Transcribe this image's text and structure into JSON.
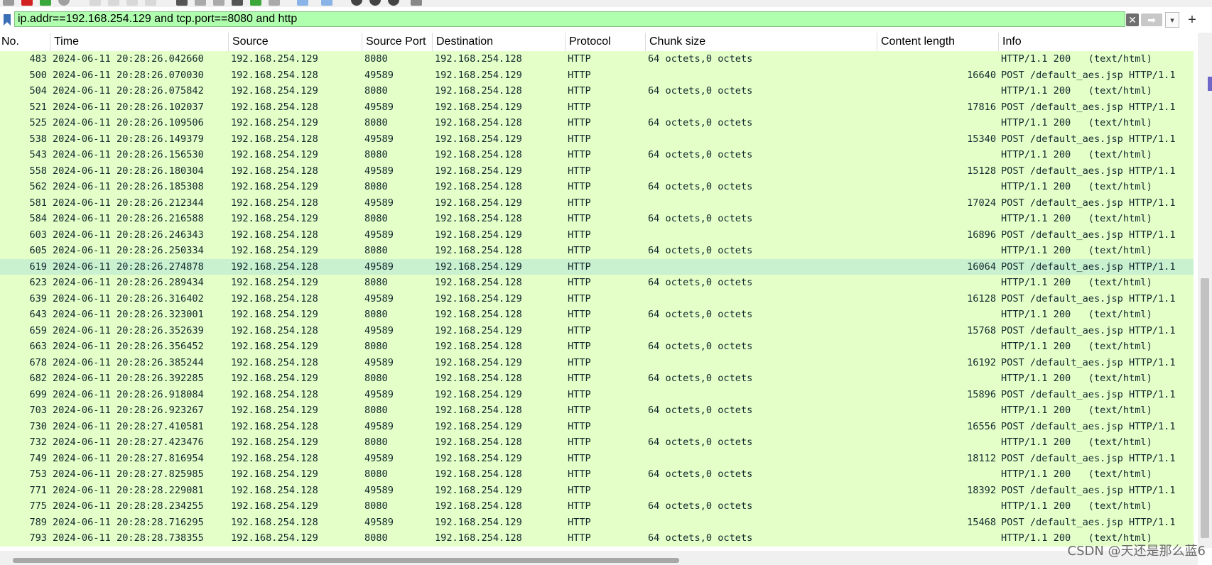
{
  "filter": {
    "value": "ip.addr==192.168.254.129 and tcp.port==8080 and http",
    "clear_glyph": "✕",
    "apply_glyph": "➡",
    "recent_glyph": "▾",
    "add_glyph": "+"
  },
  "columns": [
    "No.",
    "Time",
    "Source",
    "Source Port",
    "Destination",
    "Protocol",
    "Chunk size",
    "Content length",
    "Info"
  ],
  "rows": [
    {
      "no": "483",
      "time": "2024-06-11 20:28:26.042660",
      "src": "192.168.254.129",
      "sport": "8080",
      "dst": "192.168.254.128",
      "proto": "HTTP",
      "chunk": "64 octets,0 octets",
      "clen": "",
      "info": "HTTP/1.1 200   (text/html)"
    },
    {
      "no": "500",
      "time": "2024-06-11 20:28:26.070030",
      "src": "192.168.254.128",
      "sport": "49589",
      "dst": "192.168.254.129",
      "proto": "HTTP",
      "chunk": "",
      "clen": "16640",
      "info": "POST /default_aes.jsp HTTP/1.1"
    },
    {
      "no": "504",
      "time": "2024-06-11 20:28:26.075842",
      "src": "192.168.254.129",
      "sport": "8080",
      "dst": "192.168.254.128",
      "proto": "HTTP",
      "chunk": "64 octets,0 octets",
      "clen": "",
      "info": "HTTP/1.1 200   (text/html)"
    },
    {
      "no": "521",
      "time": "2024-06-11 20:28:26.102037",
      "src": "192.168.254.128",
      "sport": "49589",
      "dst": "192.168.254.129",
      "proto": "HTTP",
      "chunk": "",
      "clen": "17816",
      "info": "POST /default_aes.jsp HTTP/1.1"
    },
    {
      "no": "525",
      "time": "2024-06-11 20:28:26.109506",
      "src": "192.168.254.129",
      "sport": "8080",
      "dst": "192.168.254.128",
      "proto": "HTTP",
      "chunk": "64 octets,0 octets",
      "clen": "",
      "info": "HTTP/1.1 200   (text/html)"
    },
    {
      "no": "538",
      "time": "2024-06-11 20:28:26.149379",
      "src": "192.168.254.128",
      "sport": "49589",
      "dst": "192.168.254.129",
      "proto": "HTTP",
      "chunk": "",
      "clen": "15340",
      "info": "POST /default_aes.jsp HTTP/1.1"
    },
    {
      "no": "543",
      "time": "2024-06-11 20:28:26.156530",
      "src": "192.168.254.129",
      "sport": "8080",
      "dst": "192.168.254.128",
      "proto": "HTTP",
      "chunk": "64 octets,0 octets",
      "clen": "",
      "info": "HTTP/1.1 200   (text/html)"
    },
    {
      "no": "558",
      "time": "2024-06-11 20:28:26.180304",
      "src": "192.168.254.128",
      "sport": "49589",
      "dst": "192.168.254.129",
      "proto": "HTTP",
      "chunk": "",
      "clen": "15128",
      "info": "POST /default_aes.jsp HTTP/1.1"
    },
    {
      "no": "562",
      "time": "2024-06-11 20:28:26.185308",
      "src": "192.168.254.129",
      "sport": "8080",
      "dst": "192.168.254.128",
      "proto": "HTTP",
      "chunk": "64 octets,0 octets",
      "clen": "",
      "info": "HTTP/1.1 200   (text/html)"
    },
    {
      "no": "581",
      "time": "2024-06-11 20:28:26.212344",
      "src": "192.168.254.128",
      "sport": "49589",
      "dst": "192.168.254.129",
      "proto": "HTTP",
      "chunk": "",
      "clen": "17024",
      "info": "POST /default_aes.jsp HTTP/1.1"
    },
    {
      "no": "584",
      "time": "2024-06-11 20:28:26.216588",
      "src": "192.168.254.129",
      "sport": "8080",
      "dst": "192.168.254.128",
      "proto": "HTTP",
      "chunk": "64 octets,0 octets",
      "clen": "",
      "info": "HTTP/1.1 200   (text/html)"
    },
    {
      "no": "603",
      "time": "2024-06-11 20:28:26.246343",
      "src": "192.168.254.128",
      "sport": "49589",
      "dst": "192.168.254.129",
      "proto": "HTTP",
      "chunk": "",
      "clen": "16896",
      "info": "POST /default_aes.jsp HTTP/1.1"
    },
    {
      "no": "605",
      "time": "2024-06-11 20:28:26.250334",
      "src": "192.168.254.129",
      "sport": "8080",
      "dst": "192.168.254.128",
      "proto": "HTTP",
      "chunk": "64 octets,0 octets",
      "clen": "",
      "info": "HTTP/1.1 200   (text/html)"
    },
    {
      "no": "619",
      "time": "2024-06-11 20:28:26.274878",
      "src": "192.168.254.128",
      "sport": "49589",
      "dst": "192.168.254.129",
      "proto": "HTTP",
      "chunk": "",
      "clen": "16064",
      "info": "POST /default_aes.jsp HTTP/1.1",
      "selected": true
    },
    {
      "no": "623",
      "time": "2024-06-11 20:28:26.289434",
      "src": "192.168.254.129",
      "sport": "8080",
      "dst": "192.168.254.128",
      "proto": "HTTP",
      "chunk": "64 octets,0 octets",
      "clen": "",
      "info": "HTTP/1.1 200   (text/html)"
    },
    {
      "no": "639",
      "time": "2024-06-11 20:28:26.316402",
      "src": "192.168.254.128",
      "sport": "49589",
      "dst": "192.168.254.129",
      "proto": "HTTP",
      "chunk": "",
      "clen": "16128",
      "info": "POST /default_aes.jsp HTTP/1.1"
    },
    {
      "no": "643",
      "time": "2024-06-11 20:28:26.323001",
      "src": "192.168.254.129",
      "sport": "8080",
      "dst": "192.168.254.128",
      "proto": "HTTP",
      "chunk": "64 octets,0 octets",
      "clen": "",
      "info": "HTTP/1.1 200   (text/html)"
    },
    {
      "no": "659",
      "time": "2024-06-11 20:28:26.352639",
      "src": "192.168.254.128",
      "sport": "49589",
      "dst": "192.168.254.129",
      "proto": "HTTP",
      "chunk": "",
      "clen": "15768",
      "info": "POST /default_aes.jsp HTTP/1.1"
    },
    {
      "no": "663",
      "time": "2024-06-11 20:28:26.356452",
      "src": "192.168.254.129",
      "sport": "8080",
      "dst": "192.168.254.128",
      "proto": "HTTP",
      "chunk": "64 octets,0 octets",
      "clen": "",
      "info": "HTTP/1.1 200   (text/html)"
    },
    {
      "no": "678",
      "time": "2024-06-11 20:28:26.385244",
      "src": "192.168.254.128",
      "sport": "49589",
      "dst": "192.168.254.129",
      "proto": "HTTP",
      "chunk": "",
      "clen": "16192",
      "info": "POST /default_aes.jsp HTTP/1.1"
    },
    {
      "no": "682",
      "time": "2024-06-11 20:28:26.392285",
      "src": "192.168.254.129",
      "sport": "8080",
      "dst": "192.168.254.128",
      "proto": "HTTP",
      "chunk": "64 octets,0 octets",
      "clen": "",
      "info": "HTTP/1.1 200   (text/html)"
    },
    {
      "no": "699",
      "time": "2024-06-11 20:28:26.918084",
      "src": "192.168.254.128",
      "sport": "49589",
      "dst": "192.168.254.129",
      "proto": "HTTP",
      "chunk": "",
      "clen": "15896",
      "info": "POST /default_aes.jsp HTTP/1.1"
    },
    {
      "no": "703",
      "time": "2024-06-11 20:28:26.923267",
      "src": "192.168.254.129",
      "sport": "8080",
      "dst": "192.168.254.128",
      "proto": "HTTP",
      "chunk": "64 octets,0 octets",
      "clen": "",
      "info": "HTTP/1.1 200   (text/html)"
    },
    {
      "no": "730",
      "time": "2024-06-11 20:28:27.410581",
      "src": "192.168.254.128",
      "sport": "49589",
      "dst": "192.168.254.129",
      "proto": "HTTP",
      "chunk": "",
      "clen": "16556",
      "info": "POST /default_aes.jsp HTTP/1.1"
    },
    {
      "no": "732",
      "time": "2024-06-11 20:28:27.423476",
      "src": "192.168.254.129",
      "sport": "8080",
      "dst": "192.168.254.128",
      "proto": "HTTP",
      "chunk": "64 octets,0 octets",
      "clen": "",
      "info": "HTTP/1.1 200   (text/html)"
    },
    {
      "no": "749",
      "time": "2024-06-11 20:28:27.816954",
      "src": "192.168.254.128",
      "sport": "49589",
      "dst": "192.168.254.129",
      "proto": "HTTP",
      "chunk": "",
      "clen": "18112",
      "info": "POST /default_aes.jsp HTTP/1.1"
    },
    {
      "no": "753",
      "time": "2024-06-11 20:28:27.825985",
      "src": "192.168.254.129",
      "sport": "8080",
      "dst": "192.168.254.128",
      "proto": "HTTP",
      "chunk": "64 octets,0 octets",
      "clen": "",
      "info": "HTTP/1.1 200   (text/html)"
    },
    {
      "no": "771",
      "time": "2024-06-11 20:28:28.229081",
      "src": "192.168.254.128",
      "sport": "49589",
      "dst": "192.168.254.129",
      "proto": "HTTP",
      "chunk": "",
      "clen": "18392",
      "info": "POST /default_aes.jsp HTTP/1.1"
    },
    {
      "no": "775",
      "time": "2024-06-11 20:28:28.234255",
      "src": "192.168.254.129",
      "sport": "8080",
      "dst": "192.168.254.128",
      "proto": "HTTP",
      "chunk": "64 octets,0 octets",
      "clen": "",
      "info": "HTTP/1.1 200   (text/html)"
    },
    {
      "no": "789",
      "time": "2024-06-11 20:28:28.716295",
      "src": "192.168.254.128",
      "sport": "49589",
      "dst": "192.168.254.129",
      "proto": "HTTP",
      "chunk": "",
      "clen": "15468",
      "info": "POST /default_aes.jsp HTTP/1.1"
    },
    {
      "no": "793",
      "time": "2024-06-11 20:28:28.738355",
      "src": "192.168.254.129",
      "sport": "8080",
      "dst": "192.168.254.128",
      "proto": "HTTP",
      "chunk": "64 octets,0 octets",
      "clen": "",
      "info": "HTTP/1.1 200   (text/html)"
    }
  ],
  "watermark": "CSDN @天还是那么蓝6",
  "colors": {
    "filter_valid_bg": "#afffaf",
    "http_row_bg": "#e4ffc7",
    "selected_row_bg": "#c9f0cf"
  }
}
